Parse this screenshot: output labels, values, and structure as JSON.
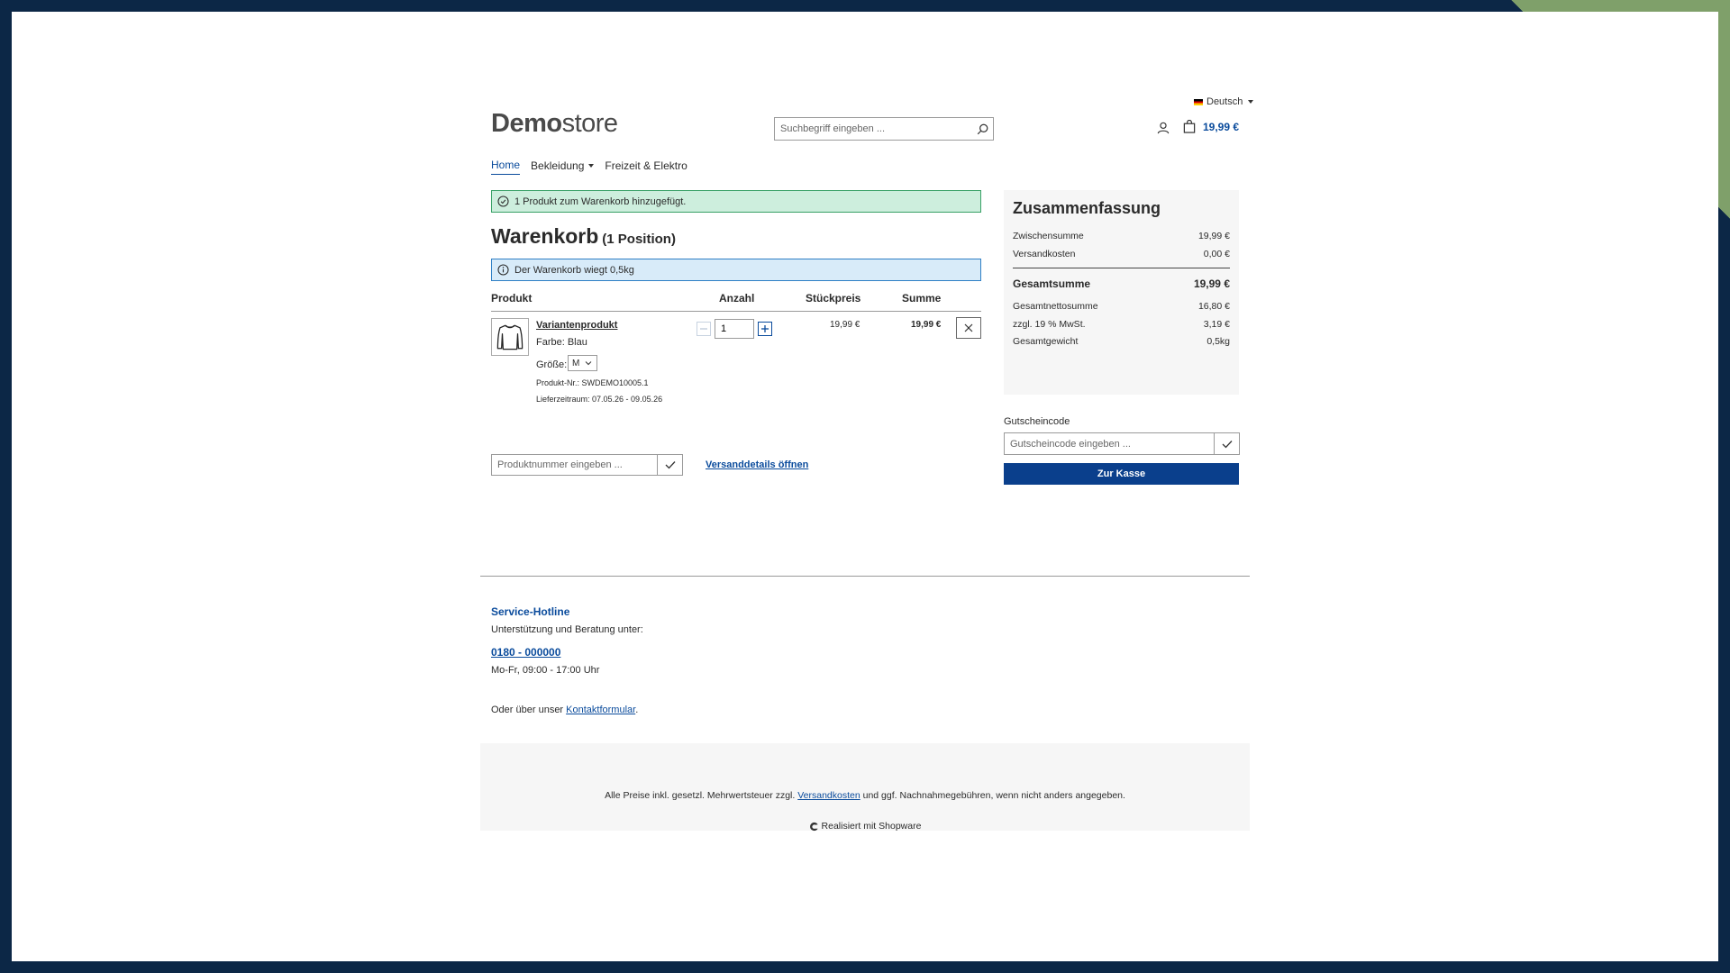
{
  "header": {
    "language": "Deutsch",
    "logo_bold": "Demo",
    "logo_regular": "store",
    "search_placeholder": "Suchbegriff eingeben ...",
    "cart_total": "19,99 €"
  },
  "nav": {
    "items": [
      {
        "label": "Home",
        "active": true
      },
      {
        "label": "Bekleidung",
        "dropdown": true
      },
      {
        "label": "Freizeit & Elektro"
      }
    ]
  },
  "alerts": {
    "success": "1 Produkt zum Warenkorb hinzugefügt.",
    "info": "Der Warenkorb wiegt 0,5kg"
  },
  "cart": {
    "title": "Warenkorb",
    "count": "(1 Position)",
    "columns": [
      "Produkt",
      "Anzahl",
      "Stückpreis",
      "Summe"
    ],
    "item": {
      "name": "Variantenprodukt",
      "color": "Farbe: Blau",
      "size_label": "Größe:",
      "size_value": "M",
      "product_nr": "Produkt-Nr.: SWDEMO10005.1",
      "delivery": "Lieferzeitraum: 07.05.26 - 09.05.26",
      "quantity": "1",
      "unit_price": "19,99 €",
      "total": "19,99 €"
    },
    "add_product_placeholder": "Produktnummer eingeben ...",
    "shipping_link": "Versanddetails öffnen"
  },
  "summary": {
    "title": "Zusammenfassung",
    "subtotal_label": "Zwischensumme",
    "subtotal": "19,99 €",
    "shipping_label": "Versandkosten",
    "shipping": "0,00 €",
    "total_label": "Gesamtsumme",
    "total": "19,99 €",
    "net_label": "Gesamtnettosumme",
    "net": "16,80 €",
    "vat_label": "zzgl. 19 % MwSt.",
    "vat": "3,19 €",
    "weight_label": "Gesamtgewicht",
    "weight": "0,5kg",
    "coupon_label": "Gutscheincode",
    "coupon_placeholder": "Gutscheincode eingeben ...",
    "checkout_label": "Zur Kasse"
  },
  "footer": {
    "hotline_title": "Service-Hotline",
    "hotline_sub": "Unterstützung und Beratung unter:",
    "phone": "0180 - 000000",
    "hours": "Mo-Fr, 09:00 - 17:00 Uhr",
    "contact_prefix": "Oder über unser ",
    "contact_link": "Kontaktformular",
    "contact_suffix": ".",
    "vat_prefix": "Alle Preise inkl. gesetzl. Mehrwertsteuer zzgl. ",
    "vat_link": "Versandkosten",
    "vat_suffix": " und ggf. Nachnahmegebühren, wenn nicht anders angegeben.",
    "powered": "Realisiert mit Shopware"
  },
  "colors": {
    "accent": "#0a4b9c",
    "frame": "#0c2746",
    "success_bg": "#cdeedd",
    "info_bg": "#d8ebf9"
  }
}
